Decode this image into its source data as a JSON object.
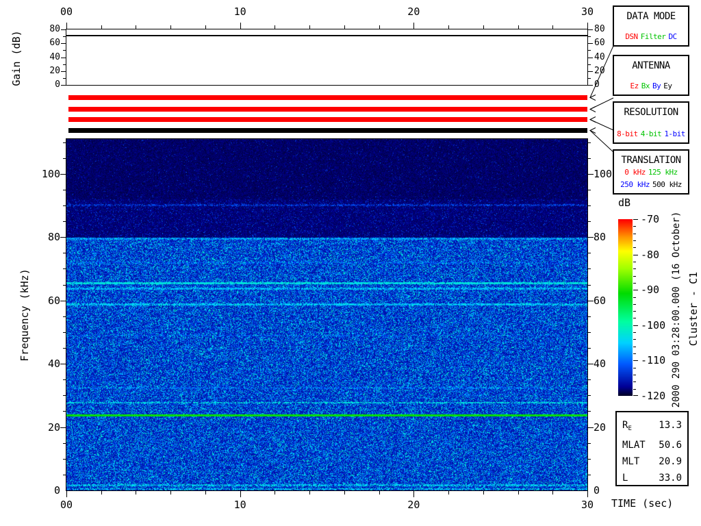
{
  "palette": {
    "red": "#ff0000",
    "green": "#00c300",
    "blue": "#0000ff",
    "black": "#000000"
  },
  "labels": {
    "gain_ylabel": "Gain (dB)",
    "freq_ylabel": "Frequency (kHz)",
    "time_xlabel": "TIME (sec)",
    "colorbar_label": "dB",
    "datetime": "2000 290 03:28:00.000 (16 October)",
    "spacecraft": "Cluster - C1"
  },
  "time_axis": {
    "xlim": [
      0,
      30
    ],
    "major_ticks": [
      0,
      10,
      20,
      30
    ],
    "labels": [
      "00",
      "10",
      "20",
      "30"
    ],
    "minor_step": 2
  },
  "gain_axis": {
    "ylim": [
      0,
      80
    ],
    "major_ticks": [
      0,
      20,
      40,
      60,
      80
    ],
    "minor_step": 10
  },
  "freq_axis": {
    "ylim": [
      0,
      111
    ],
    "major_ticks": [
      20,
      40,
      60,
      80,
      100
    ],
    "minor_step": 5,
    "zero_label": "0"
  },
  "status_bars": [
    {
      "name": "data-mode",
      "color": "#ff0000"
    },
    {
      "name": "antenna",
      "color": "#ff0000"
    },
    {
      "name": "resolution",
      "color": "#ff0000"
    },
    {
      "name": "translation",
      "color": "#000000"
    }
  ],
  "info_boxes": [
    {
      "id": "data-mode",
      "title": "DATA MODE",
      "items": [
        {
          "text": "DSN",
          "color": "red",
          "row": 0
        },
        {
          "text": "Filter",
          "color": "green",
          "row": 0
        },
        {
          "text": "DC",
          "color": "blue",
          "row": 0
        }
      ]
    },
    {
      "id": "antenna",
      "title": "ANTENNA",
      "items": [
        {
          "text": "Ez",
          "color": "red",
          "row": 0
        },
        {
          "text": "Bx",
          "color": "green",
          "row": 0
        },
        {
          "text": "By",
          "color": "blue",
          "row": 0
        },
        {
          "text": "Ey",
          "color": "black",
          "row": 0
        }
      ]
    },
    {
      "id": "resolution",
      "title": "RESOLUTION",
      "items": [
        {
          "text": "8-bit",
          "color": "red",
          "row": 0
        },
        {
          "text": "4-bit",
          "color": "green",
          "row": 0
        },
        {
          "text": "1-bit",
          "color": "blue",
          "row": 0
        }
      ]
    },
    {
      "id": "translation",
      "title": "TRANSLATION",
      "items": [
        {
          "text": "0 kHz",
          "color": "red",
          "row": 0
        },
        {
          "text": "125 kHz",
          "color": "green",
          "row": 0
        },
        {
          "text": "250 kHz",
          "color": "blue",
          "row": 1
        },
        {
          "text": "500 kHz",
          "color": "black",
          "row": 1
        }
      ]
    }
  ],
  "ephemeris": {
    "rows": [
      {
        "label": "R",
        "sub": "E",
        "value": "13.3"
      },
      {
        "label": "MLAT",
        "sub": "",
        "value": "50.6"
      },
      {
        "label": "MLT",
        "sub": "",
        "value": "20.9"
      },
      {
        "label": "L",
        "sub": "",
        "value": "33.0"
      }
    ]
  },
  "chart_data": [
    {
      "type": "line",
      "name": "gain-panel",
      "ylabel": "Gain (dB)",
      "xlim": [
        0,
        30
      ],
      "ylim": [
        0,
        80
      ],
      "x": [
        0,
        30
      ],
      "values": [
        72,
        72
      ],
      "yticks": [
        0,
        20,
        40,
        60,
        80
      ],
      "xticks": [
        0,
        10,
        20,
        30
      ],
      "xtick_labels": [
        "00",
        "10",
        "20",
        "30"
      ]
    },
    {
      "type": "heatmap",
      "name": "wbd-spectrogram",
      "xlabel": "TIME (sec)",
      "ylabel": "Frequency (kHz)",
      "xlim": [
        0,
        30
      ],
      "ylim": [
        0,
        111
      ],
      "yticks": [
        0,
        20,
        40,
        60,
        80,
        100
      ],
      "xticks": [
        0,
        10,
        20,
        30
      ],
      "xtick_labels": [
        "00",
        "10",
        "20",
        "30"
      ],
      "colorbar": {
        "label": "dB",
        "min": -120,
        "max": -70,
        "ticks": [
          -70,
          -80,
          -90,
          -100,
          -110,
          -120
        ],
        "colormap": "rainbow"
      },
      "noise_regions": [
        {
          "freq_range_khz": [
            92,
            111
          ],
          "floor_db": -119.5,
          "speckle_prob": 0.05,
          "speckle_boost_db": 6
        },
        {
          "freq_range_khz": [
            80,
            92
          ],
          "floor_db": -119.2,
          "speckle_prob": 0.14,
          "speckle_boost_db": 7
        },
        {
          "freq_range_khz": [
            0,
            80
          ],
          "floor_db": -117.0,
          "speckle_prob": 0.62,
          "speckle_boost_db": 15
        }
      ],
      "spectral_lines": [
        {
          "freq_khz": 90.3,
          "level_db": -112,
          "halfwidth_khz": 0.3,
          "gap": 0.5
        },
        {
          "freq_khz": 79.7,
          "level_db": -107,
          "halfwidth_khz": 0.35,
          "gap": 0.38
        },
        {
          "freq_khz": 72.0,
          "level_db": -112,
          "halfwidth_khz": 0.3,
          "gap": 0.55
        },
        {
          "freq_khz": 65.5,
          "level_db": -103,
          "halfwidth_khz": 0.33,
          "gap": 0.1
        },
        {
          "freq_khz": 63.9,
          "level_db": -106,
          "halfwidth_khz": 0.3,
          "gap": 0.3
        },
        {
          "freq_khz": 58.9,
          "level_db": -105,
          "halfwidth_khz": 0.3,
          "gap": 0.25
        },
        {
          "freq_khz": 49.0,
          "level_db": -112,
          "halfwidth_khz": 0.3,
          "gap": 0.6
        },
        {
          "freq_khz": 32.5,
          "level_db": -110,
          "halfwidth_khz": 0.3,
          "gap": 0.55
        },
        {
          "freq_khz": 27.8,
          "level_db": -103,
          "halfwidth_khz": 0.3,
          "gap": 0.35
        },
        {
          "freq_khz": 23.9,
          "level_db": -91,
          "halfwidth_khz": 0.33,
          "gap": 0.0
        },
        {
          "freq_khz": 1.8,
          "level_db": -104,
          "halfwidth_khz": 0.3,
          "gap": 0.45
        },
        {
          "freq_khz": 0.5,
          "level_db": -104,
          "halfwidth_khz": 0.25,
          "gap": 0.5
        }
      ]
    }
  ]
}
